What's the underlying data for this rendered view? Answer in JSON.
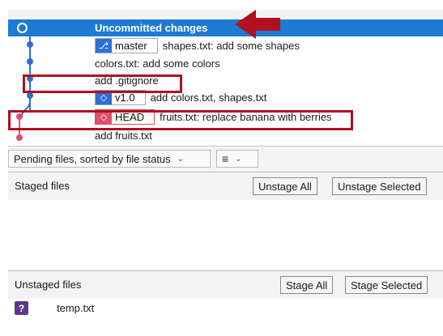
{
  "commits": [
    {
      "message": "Uncommitted changes",
      "selected": true
    },
    {
      "ref": {
        "kind": "branch",
        "label": "master",
        "icon": "branch-icon"
      },
      "message": "shapes.txt: add some shapes"
    },
    {
      "message": "colors.txt: add some colors"
    },
    {
      "message": "add .gitignore"
    },
    {
      "ref": {
        "kind": "tag",
        "label": "v1.0",
        "icon": "tag-icon"
      },
      "message": "add colors.txt, shapes.txt"
    },
    {
      "ref": {
        "kind": "head",
        "label": "HEAD",
        "icon": "tag-icon"
      },
      "message": "fruits.txt: replace banana with berries"
    },
    {
      "message": "add fruits.txt"
    }
  ],
  "toolbar": {
    "sort_value": "Pending files, sorted by file status",
    "view_icon": "list-view-icon"
  },
  "staged": {
    "title": "Staged files",
    "unstage_all": "Unstage All",
    "unstage_selected": "Unstage Selected"
  },
  "unstaged": {
    "title": "Unstaged files",
    "stage_all": "Stage All",
    "stage_selected": "Stage Selected",
    "files": [
      {
        "name": "temp.txt",
        "status_icon": "question-icon",
        "status_glyph": "?"
      }
    ]
  },
  "colors": {
    "selected_row": "#1e7bd3",
    "annotation": "#b01020",
    "graph_line_blue": "#2d6fd6",
    "graph_line_pink": "#e0506a"
  }
}
